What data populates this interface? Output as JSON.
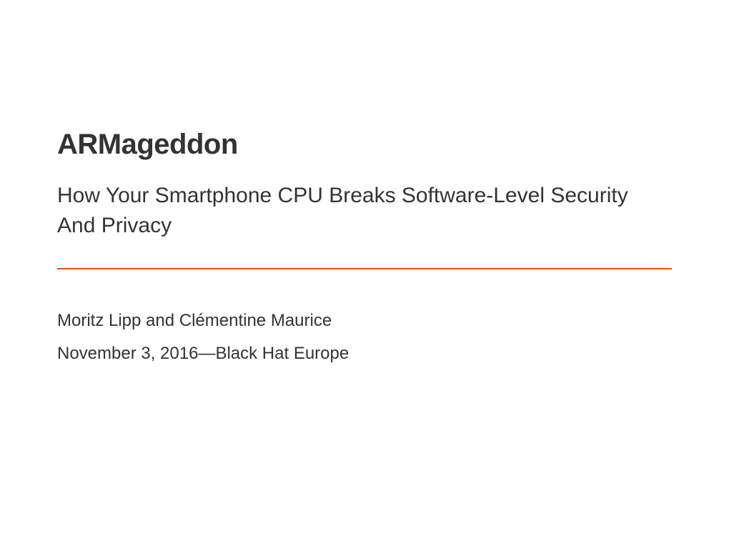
{
  "slide": {
    "title": "ARMageddon",
    "subtitle": "How Your Smartphone CPU Breaks Software-Level Security And Privacy",
    "authors": "Moritz Lipp and Clémentine Maurice",
    "date_venue": "November 3, 2016—Black Hat Europe"
  },
  "colors": {
    "divider": "#e94e1b",
    "text": "#333333",
    "background": "#ffffff"
  }
}
